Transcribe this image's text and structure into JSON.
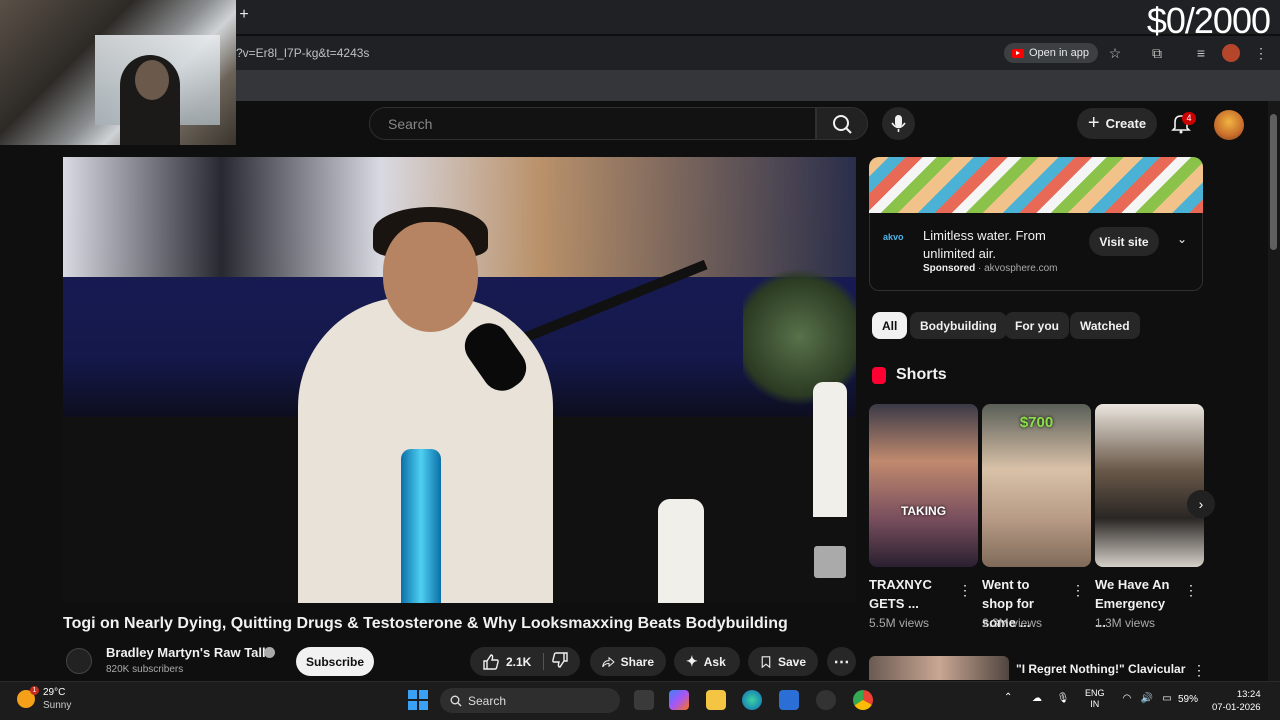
{
  "browser": {
    "new_tab_icon": "+",
    "url": "?v=Er8l_I7P-kg&t=4243s",
    "open_in_app": "Open in app"
  },
  "overlay": {
    "counter": "$0/2000"
  },
  "youtube": {
    "search_placeholder": "Search",
    "create_label": "Create",
    "notification_count": "4"
  },
  "video": {
    "title": "Togi on Nearly Dying, Quitting Drugs & Testosterone & Why Looksmaxxing Beats Bodybuilding",
    "channel": "Bradley Martyn's Raw Talk",
    "subscribers": "820K subscribers",
    "subscribe_label": "Subscribe",
    "likes": "2.1K",
    "share_label": "Share",
    "ask_label": "Ask",
    "save_label": "Save"
  },
  "ad": {
    "headline": "Limitless water. From unlimited air.",
    "sponsored": "Sponsored",
    "domain": "akvosphere.com",
    "visit_label": "Visit site",
    "logo": "akvo"
  },
  "chips": [
    "All",
    "Bodybuilding",
    "For you",
    "Watched"
  ],
  "shorts": {
    "label": "Shorts",
    "items": [
      {
        "title": "TRAXNYC GETS ...",
        "views": "5.5M views",
        "overlay": "TAKING"
      },
      {
        "title": "Went to shop for some ...",
        "views": "2.3M views",
        "overlay": "$700"
      },
      {
        "title": "We Have An Emergency ...",
        "views": "1.3M views",
        "overlay": ""
      }
    ]
  },
  "next_video": {
    "title": "\"I Regret Nothing!\" Clavicular"
  },
  "taskbar": {
    "temperature": "29°C",
    "condition": "Sunny",
    "search_label": "Search",
    "lang_top": "ENG",
    "lang_bottom": "IN",
    "battery": "59%",
    "time": "13:24",
    "date": "07-01-2026"
  },
  "colors": {
    "accent_red": "#ff0000",
    "bg": "#0f0f0f",
    "chip_bg": "#272727"
  }
}
